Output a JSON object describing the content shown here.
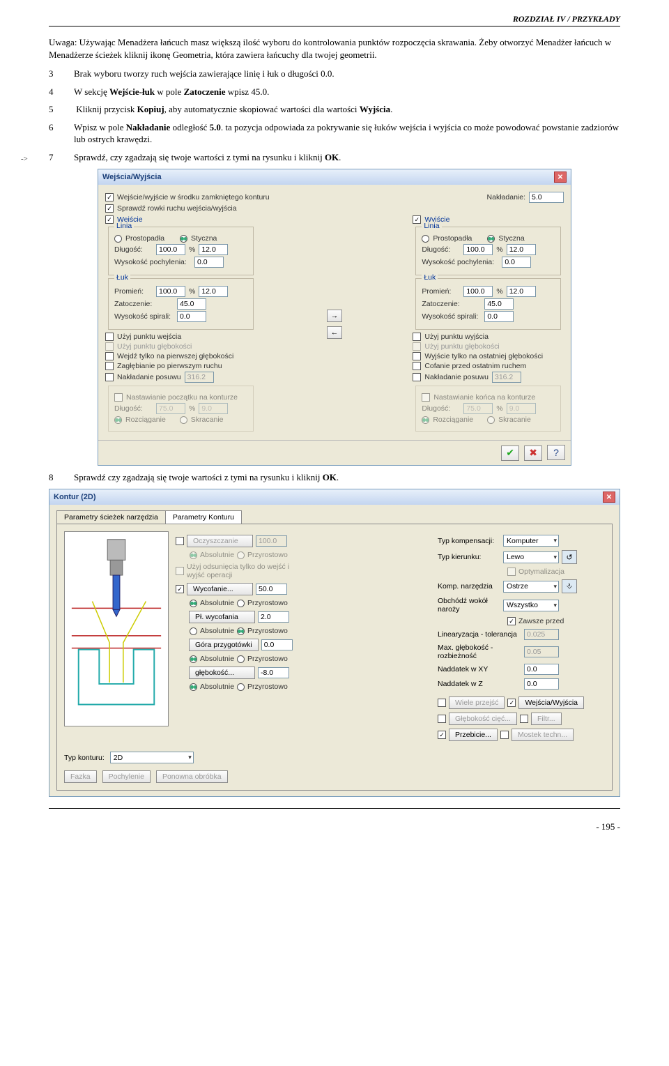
{
  "header": {
    "chapter": "ROZDZIAŁ IV / PRZYKŁADY"
  },
  "intro": {
    "note": "Uwaga: Używając Menadżera łańcuch masz większą ilość wyboru do kontrolowania punktów rozpoczęcia skrawania. Żeby otworzyć Menadżer łańcuch w Menadżerze ścieżek kliknij ikonę Geometria, która zawiera łańcuchy dla twojej geometrii."
  },
  "margin_hint": "->",
  "steps": {
    "s3": "Brak wyboru tworzy ruch wejścia zawierające linię i łuk o długości 0.0.",
    "s4_a": "W sekcję ",
    "s4_b": "Wejście-łuk",
    "s4_c": " w pole ",
    "s4_d": "Zatoczenie",
    "s4_e": " wpisz 45.0.",
    "s5_a": "Kliknij przycisk ",
    "s5_b": "Kopiuj",
    "s5_c": ", aby automatycznie skopiować wartości dla wartości ",
    "s5_d": "Wyjścia",
    "s5_e": ".",
    "s6_a": "Wpisz w pole ",
    "s6_b": "Nakładanie",
    "s6_c": " odległość ",
    "s6_d": "5.0",
    "s6_e": ". ta pozycja odpowiada za pokrywanie się łuków wejścia i wyjścia co może powodować powstanie zadziorów lub ostrych krawędzi.",
    "s7_a": "Sprawdź, czy zgadzają się twoje wartości z tymi na rysunku i kliknij ",
    "s7_b": "OK",
    "s7_c": ".",
    "s8_a": "Sprawdź czy zgadzają się twoje wartości z tymi na rysunku i kliknij ",
    "s8_b": "OK",
    "s8_c": "."
  },
  "dlg1": {
    "title": "Wejścia/Wyjścia",
    "cb_center": "Wejście/wyjście w środku zamkniętego konturu",
    "cb_check": "Sprawdź rowki ruchu wejścia/wyjścia",
    "overlap_label": "Nakładanie:",
    "overlap_val": "5.0",
    "entry": {
      "head": "Wejście",
      "linia": "Linia",
      "perp": "Prostopadła",
      "tang": "Styczna",
      "len_l": "Długość:",
      "len_v": "100.0",
      "len_pc": "%",
      "len_abs": "12.0",
      "ang_l": "Wysokość pochylenia:",
      "ang_v": "0.0",
      "luk": "Łuk",
      "rad_l": "Promień:",
      "rad_v": "100.0",
      "rad_pc": "%",
      "rad_abs": "12.0",
      "sweep_l": "Zatoczenie:",
      "sweep_v": "45.0",
      "helix_l": "Wysokość spirali:",
      "helix_v": "0.0",
      "usept": "Użyj punktu wejścia",
      "usedepth": "Użyj punktu głębokości",
      "firstdepth": "Wejdź tylko na pierwszej głębokości",
      "plunge": "Zagłębianie po pierwszym ruchu",
      "feedover": "Nakładanie posuwu",
      "feedover_v": "316.2",
      "adj": "Nastawianie początku na konturze",
      "adj_len": "Długość:",
      "adj_v": "75.0",
      "adj_pc": "%",
      "adj_abs": "9.0",
      "ext": "Rozciąganie",
      "shr": "Skracanie"
    },
    "exit": {
      "head": "Wyjście",
      "linia": "Linia",
      "perp": "Prostopadła",
      "tang": "Styczna",
      "len_l": "Długość:",
      "len_v": "100.0",
      "len_pc": "%",
      "len_abs": "12.0",
      "ang_l": "Wysokość pochylenia:",
      "ang_v": "0.0",
      "luk": "Łuk",
      "rad_l": "Promień:",
      "rad_v": "100.0",
      "rad_pc": "%",
      "rad_abs": "12.0",
      "sweep_l": "Zatoczenie:",
      "sweep_v": "45.0",
      "helix_l": "Wysokość spirali:",
      "helix_v": "0.0",
      "usept": "Użyj punktu wyjścia",
      "usedepth": "Użyj punktu głębokości",
      "lastdepth": "Wyjście tylko na ostatniej głębokości",
      "retract": "Cofanie przed ostatnim ruchem",
      "feedover": "Nakładanie posuwu",
      "feedover_v": "316.2",
      "adj": "Nastawianie końca na konturze",
      "adj_len": "Długość:",
      "adj_v": "75.0",
      "adj_pc": "%",
      "adj_abs": "9.0",
      "ext": "Rozciąganie",
      "shr": "Skracanie"
    },
    "arrow_r": "→",
    "arrow_l": "←"
  },
  "dlg2": {
    "title": "Kontur (2D)",
    "tab1": "Parametry ścieżek narzędzia",
    "tab2": "Parametry Konturu",
    "clean": "Oczyszczanie",
    "clean_v": "100.0",
    "abs": "Absolutnie",
    "inc": "Przyrostowo",
    "useoff": "Użyj odsunięcia tylko do wejść i wyjść operacji",
    "retract_btn": "Wycofanie...",
    "retract_v": "50.0",
    "retrplane_btn": "Pł. wycofania",
    "retrplane_v": "2.0",
    "top_btn": "Góra przygotówki",
    "top_v": "0.0",
    "depth_btn": "głębokość...",
    "depth_v": "-8.0",
    "typkonturu_l": "Typ konturu:",
    "typkonturu_v": "2D",
    "fazka": "Fazka",
    "pochyl": "Pochylenie",
    "ponow": "Ponowna obróbka",
    "komp_l": "Typ kompensacji:",
    "komp_v": "Komputer",
    "kier_l": "Typ kierunku:",
    "kier_v": "Lewo",
    "opt": "Optymalizacja",
    "kompn_l": "Komp. narzędzia",
    "kompn_v": "Ostrze",
    "obchod_l": "Obchódź wokół naroży",
    "obchod_v": "Wszystko",
    "zawsze": "Zawsze przed",
    "lin_l": "Linearyzacja - tolerancja",
    "lin_v": "0.025",
    "maxg_l": "Max. głębokość - rozbieżność",
    "maxg_v": "0.05",
    "nxy_l": "Naddatek w XY",
    "nxy_v": "0.0",
    "nz_l": "Naddatek w Z",
    "nz_v": "0.0",
    "multi": "Wiele przejść",
    "wej": "Wejścia/Wyjścia",
    "glc": "Głębokość cięć...",
    "filtr": "Filtr...",
    "przeb": "Przebicie...",
    "mostek": "Mostek techn..."
  },
  "footer": {
    "page": "- 195 -"
  }
}
